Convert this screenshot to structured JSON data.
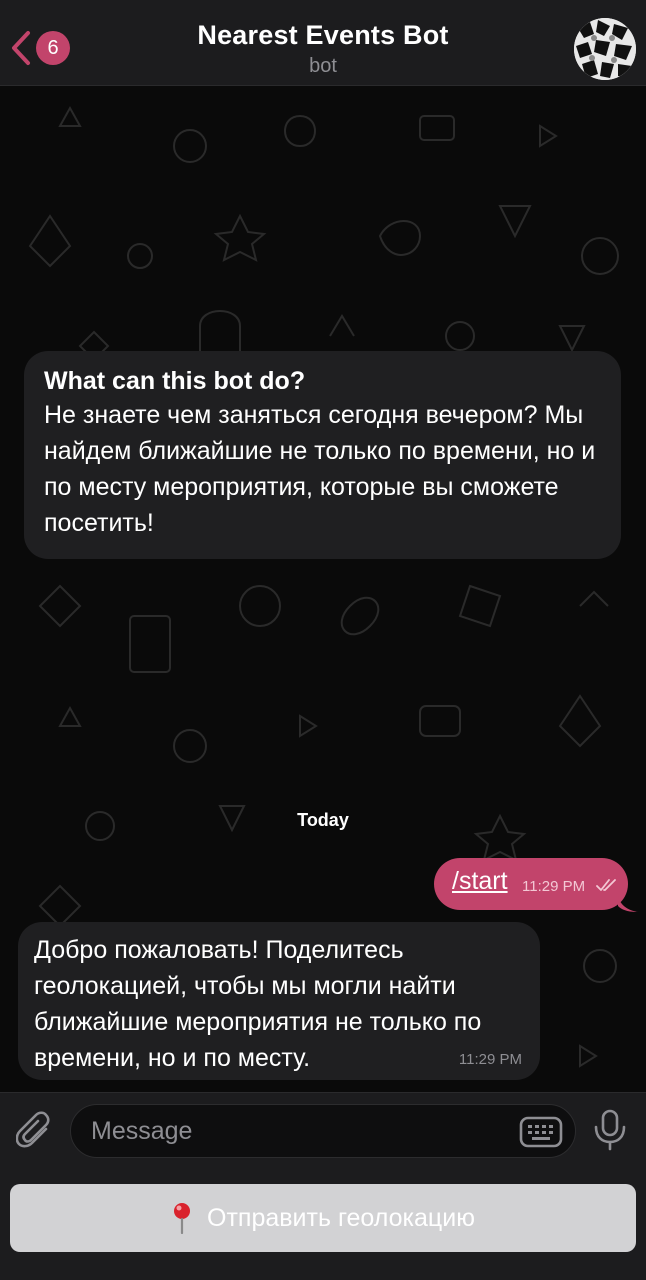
{
  "header": {
    "back_count": "6",
    "title": "Nearest Events Bot",
    "subtitle": "bot"
  },
  "intro": {
    "title": "What can this bot do?",
    "text": "Не знаете чем заняться сегодня вечером? Мы найдем ближайшие не только по времени, но и по месту мероприятия, которые вы сможете посетить!"
  },
  "date_separator": "Today",
  "messages": [
    {
      "direction": "outgoing",
      "text": "/start",
      "time": "11:29 PM",
      "status": "read"
    },
    {
      "direction": "incoming",
      "text": "Добро пожаловать! Поделитесь геолокацией, чтобы мы могли найти ближайшие мероприятия не только по времени, но и по месту.",
      "time": "11:29 PM"
    }
  ],
  "composer": {
    "placeholder": "Message",
    "attach_icon": "paperclip-icon",
    "keyboard_icon": "keyboard-icon",
    "mic_icon": "microphone-icon"
  },
  "reply_keyboard": {
    "button_icon": "pin-icon",
    "button_label": "Отправить геолокацию"
  },
  "colors": {
    "accent": "#c2446b",
    "bubble_incoming": "#1f1f21",
    "header_bg": "#1c1c1e",
    "background": "#0a0a0a"
  }
}
